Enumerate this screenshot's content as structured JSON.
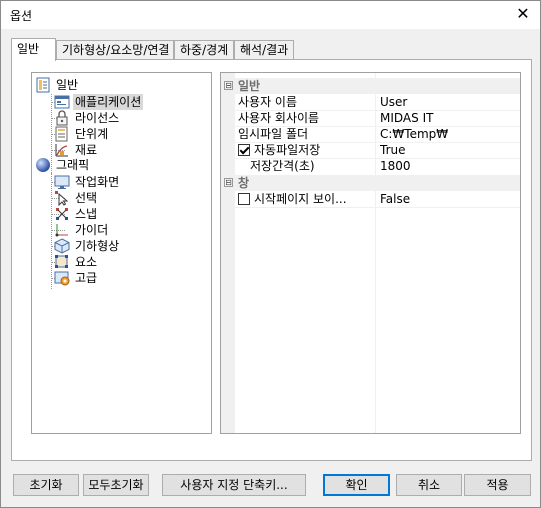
{
  "window": {
    "title": "옵션",
    "close_glyph": "✕"
  },
  "tabs": [
    {
      "label": "일반"
    },
    {
      "label": "기하형상/요소망/연결"
    },
    {
      "label": "하중/경계"
    },
    {
      "label": "해석/결과"
    }
  ],
  "tree": {
    "items": [
      {
        "label": "일반",
        "icon": "document-icon"
      },
      {
        "label": "애플리케이션",
        "icon": "application-icon"
      },
      {
        "label": "라이선스",
        "icon": "lock-icon"
      },
      {
        "label": "단위계",
        "icon": "units-icon"
      },
      {
        "label": "재료",
        "icon": "material-icon"
      },
      {
        "label": "그래픽",
        "icon": "sphere-icon"
      },
      {
        "label": "작업화면",
        "icon": "monitor-icon"
      },
      {
        "label": "선택",
        "icon": "cursor-icon"
      },
      {
        "label": "스냅",
        "icon": "snap-icon"
      },
      {
        "label": "가이더",
        "icon": "guide-icon"
      },
      {
        "label": "기하형상",
        "icon": "cube-icon"
      },
      {
        "label": "요소",
        "icon": "element-icon"
      },
      {
        "label": "고급",
        "icon": "advanced-icon"
      }
    ]
  },
  "properties": {
    "categories": [
      {
        "label": "일반",
        "toggle": "⊟",
        "rows": [
          {
            "name": "사용자 이름",
            "value": "User"
          },
          {
            "name": "사용자 회사이름",
            "value": "MIDAS IT"
          },
          {
            "name": "임시파일 폴더",
            "value": "C:₩Temp₩"
          },
          {
            "name": "자동파일저장",
            "value": "True",
            "checkbox": true
          },
          {
            "name": "저장간격(초)",
            "value": "1800"
          }
        ]
      },
      {
        "label": "창",
        "toggle": "⊟",
        "rows": [
          {
            "name": "시작페이지 보이...",
            "value": "False",
            "checkbox": false
          }
        ]
      }
    ]
  },
  "buttons": {
    "reset": "초기화",
    "reset_all": "모두초기화",
    "shortcuts": "사용자 지정 단축키...",
    "ok": "확인",
    "cancel": "취소",
    "apply": "적용"
  },
  "colors": {
    "accent": "#0078d7",
    "tree_selected": "#d9d9d9"
  }
}
